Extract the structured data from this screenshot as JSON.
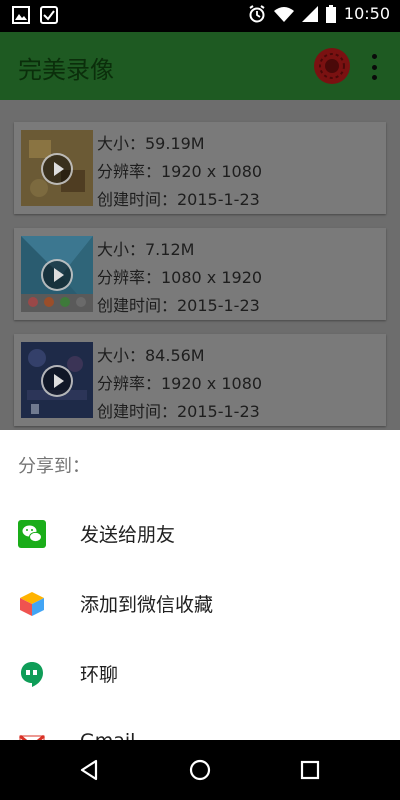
{
  "status_bar": {
    "time": "10:50"
  },
  "app_bar": {
    "title": "完美录像"
  },
  "recordings": [
    {
      "size": "大小：59.19M",
      "resolution": "分辨率：1920 x 1080",
      "created": "创建时间：2015-1-23"
    },
    {
      "size": "大小：7.12M",
      "resolution": "分辨率：1080 x 1920",
      "created": "创建时间：2015-1-23"
    },
    {
      "size": "大小：84.56M",
      "resolution": "分辨率：1920 x 1080",
      "created": "创建时间：2015-1-23"
    }
  ],
  "share_sheet": {
    "header": "分享到：",
    "options": [
      {
        "label": "发送给朋友",
        "icon": "wechat-icon"
      },
      {
        "label": "添加到微信收藏",
        "icon": "wechat-favorites-icon"
      },
      {
        "label": "环聊",
        "icon": "hangouts-icon"
      },
      {
        "label": "Gmail",
        "icon": "gmail-icon"
      }
    ]
  },
  "colors": {
    "app_bar": "#1e5a22",
    "wechat_green": "#1aad19",
    "hangouts_green": "#0f9d58",
    "gmail_red": "#d93025"
  }
}
